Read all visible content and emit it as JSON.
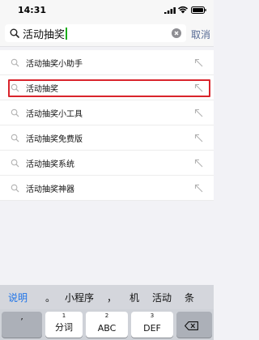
{
  "status": {
    "time": "14:31"
  },
  "search": {
    "query": "活动抽奖",
    "cancel_label": "取消"
  },
  "suggestions": [
    {
      "label": "活动抽奖小助手"
    },
    {
      "label": "活动抽奖"
    },
    {
      "label": "活动抽奖小工具"
    },
    {
      "label": "活动抽奖免费版"
    },
    {
      "label": "活动抽奖系统"
    },
    {
      "label": "活动抽奖神器"
    }
  ],
  "highlighted_index": 1,
  "candidates": [
    "说明",
    "。",
    "小程序",
    "，",
    "机",
    "活动",
    "条"
  ],
  "keyboard": {
    "punct_key": "’",
    "keys": [
      {
        "number": "1",
        "label": "分词"
      },
      {
        "number": "2",
        "label": "ABC"
      },
      {
        "number": "3",
        "label": "DEF"
      }
    ]
  },
  "colors": {
    "accent": "#1f74e8",
    "highlight": "#d9242c",
    "link": "#576b95"
  },
  "icons": [
    "signal-icon",
    "wifi-icon",
    "battery-icon",
    "search-icon",
    "clear-icon",
    "arrow-up-left-icon",
    "backspace-icon"
  ]
}
